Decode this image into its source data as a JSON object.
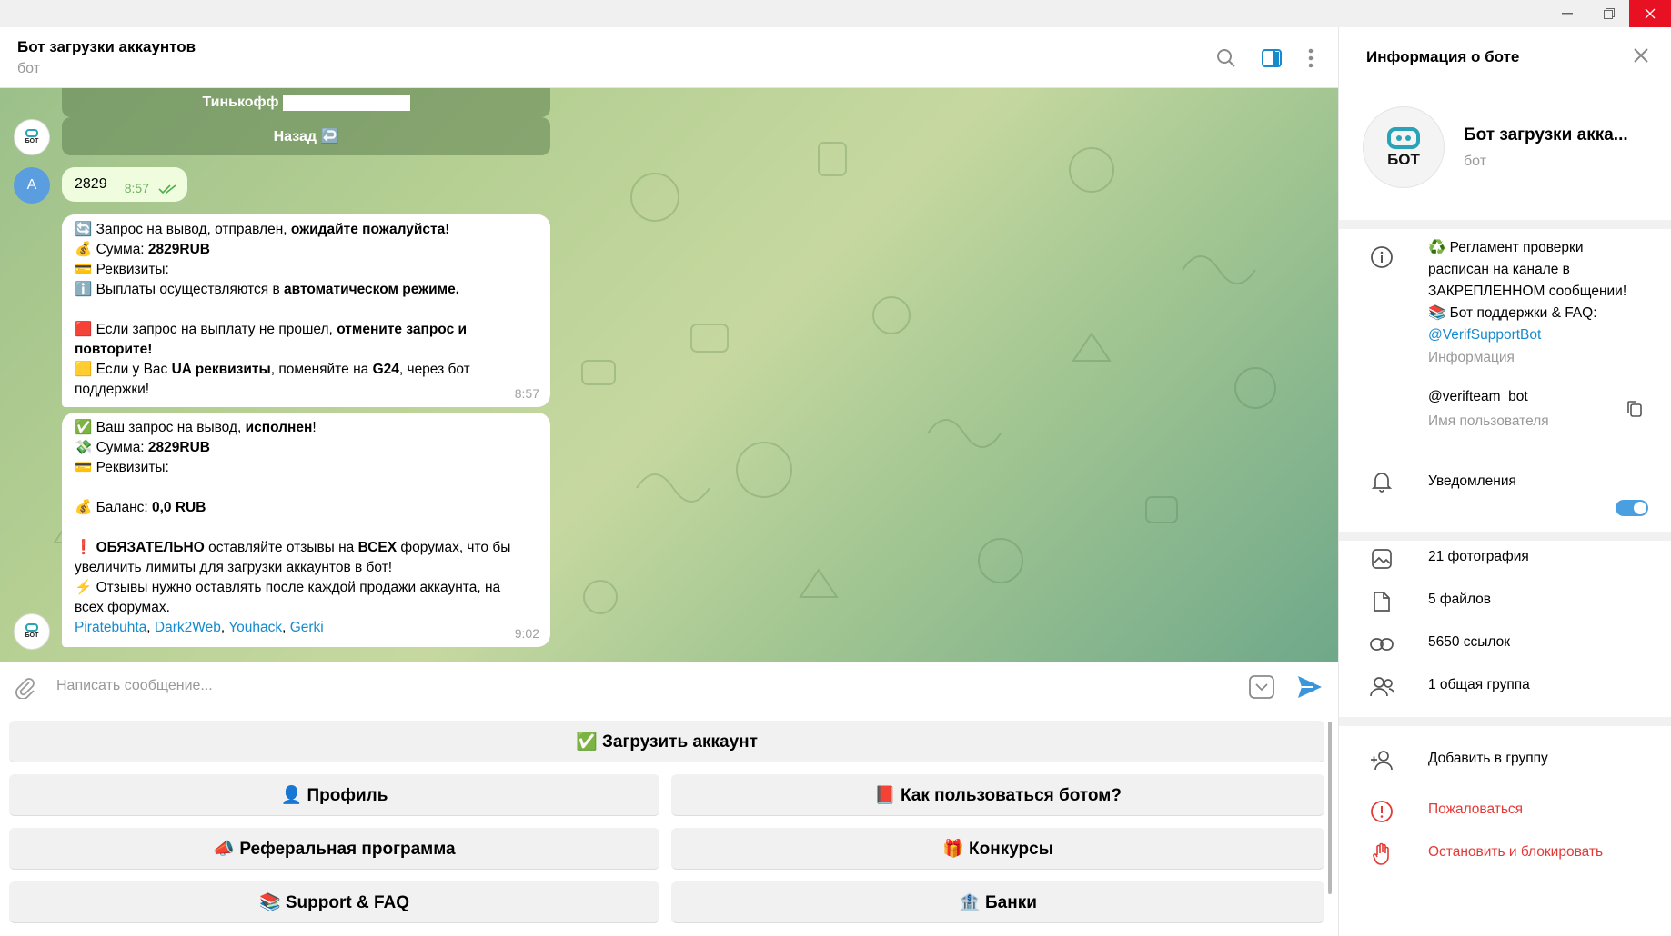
{
  "window": {
    "controls": [
      "minimize",
      "maximize",
      "close"
    ]
  },
  "chat_header": {
    "title": "Бот загрузки аккаунтов",
    "subtitle": "бот"
  },
  "inline_keyboard": {
    "buttons": [
      "Тинькофф",
      "Назад ↩️"
    ]
  },
  "bot_avatar_label": "БОТ",
  "user_avatar_label": "A",
  "messages": {
    "user_message": {
      "text": "2829",
      "time": "8:57"
    },
    "withdraw_request": {
      "l1_prefix": "🔄 Запрос на вывод,  отправлен, ",
      "l1_bold": "ожидайте пожалуйста!",
      "l2_prefix": "💰 Сумма: ",
      "l2_bold": "2829RUB",
      "l3": "💳 Реквизиты:",
      "l4_prefix": "ℹ️ Выплаты осуществляются в ",
      "l4_bold": "автоматическом режиме.",
      "l5_prefix": "🟥 Если запрос на выплату не прошел, ",
      "l5_bold": "отмените запрос и",
      "l6_bold": "повторите!",
      "l7_prefix": "🟨 Если у Вас ",
      "l7_bold1": "UA реквизиты",
      "l7_mid": ", поменяйте на ",
      "l7_bold2": "G24",
      "l7_suffix": ", через бот",
      "l8": "поддержки!",
      "time": "8:57"
    },
    "withdraw_done": {
      "l1_prefix": "✅ Ваш запрос на вывод, ",
      "l1_bold": "исполнен",
      "l1_suffix": "!",
      "l2_prefix": "💸 Сумма: ",
      "l2_bold": "2829RUB",
      "l3": "💳 Реквизиты:",
      "l4_prefix": "💰 Баланс: ",
      "l4_bold": "0,0 RUB",
      "l5_prefix": "❗ ",
      "l5_bold1": "ОБЯЗАТЕЛЬНО",
      "l5_mid": " оставляйте отзывы на ",
      "l5_bold2": "ВСЕХ",
      "l5_suffix": " форумах, что бы",
      "l6": "увеличить лимиты для загрузки аккаунтов в бот!",
      "l7": "⚡ Отзывы нужно оставлять после каждой продажи аккаунта, на",
      "l8": "всех форумах.",
      "links": [
        "Piratebuhta",
        "Dark2Web",
        "Youhack",
        "Gerki"
      ],
      "time": "9:02"
    }
  },
  "composer": {
    "placeholder": "Написать сообщение..."
  },
  "reply_keyboard": {
    "upload": "✅ Загрузить аккаунт",
    "profile": "👤 Профиль",
    "howto": "📕 Как пользоваться ботом?",
    "referral": "📣 Реферальная программа",
    "contests": "🎁 Конкурсы",
    "support": "📚 Support & FAQ",
    "banks": "🏦 Банки"
  },
  "side_panel": {
    "title": "Информация о боте",
    "bot_name": "Бот загрузки акка...",
    "bot_status": "бот",
    "info_lines": [
      "♻️ Регламент проверки",
      "расписан на канале в",
      "ЗАКРЕПЛЕННОМ сообщении!",
      "📚 Бот поддержки & FAQ:"
    ],
    "info_link": "@VerifSupportBot",
    "info_label": "Информация",
    "username": "@verifteam_bot",
    "username_label": "Имя пользователя",
    "notifications": "Уведомления",
    "notifications_on": true,
    "media": {
      "photos": "21 фотография",
      "files": "5 файлов",
      "links": "5650 ссылок",
      "groups": "1 общая группа"
    },
    "actions": {
      "add_to_group": "Добавить в группу",
      "report": "Пожаловаться",
      "block": "Остановить и блокировать"
    }
  },
  "colors": {
    "accent": "#168acd",
    "danger": "#e53935",
    "bubble_out": "#effdde",
    "toggle_on": "#4a9fe0"
  }
}
